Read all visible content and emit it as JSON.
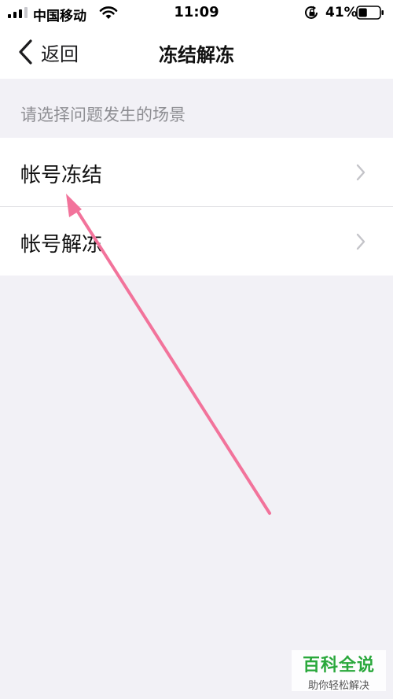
{
  "status_bar": {
    "carrier": "中国移动",
    "time": "11:09",
    "battery_percent": "41%",
    "battery_level": 0.41,
    "icons": [
      "signal-icon",
      "wifi-icon",
      "rotation-lock-icon",
      "battery-icon"
    ]
  },
  "nav": {
    "back_label": "返回",
    "title": "冻结解冻"
  },
  "section": {
    "header": "请选择问题发生的场景"
  },
  "list": {
    "items": [
      {
        "label": "帐号冻结"
      },
      {
        "label": "帐号解冻"
      }
    ]
  },
  "annotation": {
    "arrow_color": "#f2739b"
  },
  "watermark": {
    "title": "百科全说",
    "subtitle": "助你轻松解决",
    "color": "#2aa83c"
  }
}
